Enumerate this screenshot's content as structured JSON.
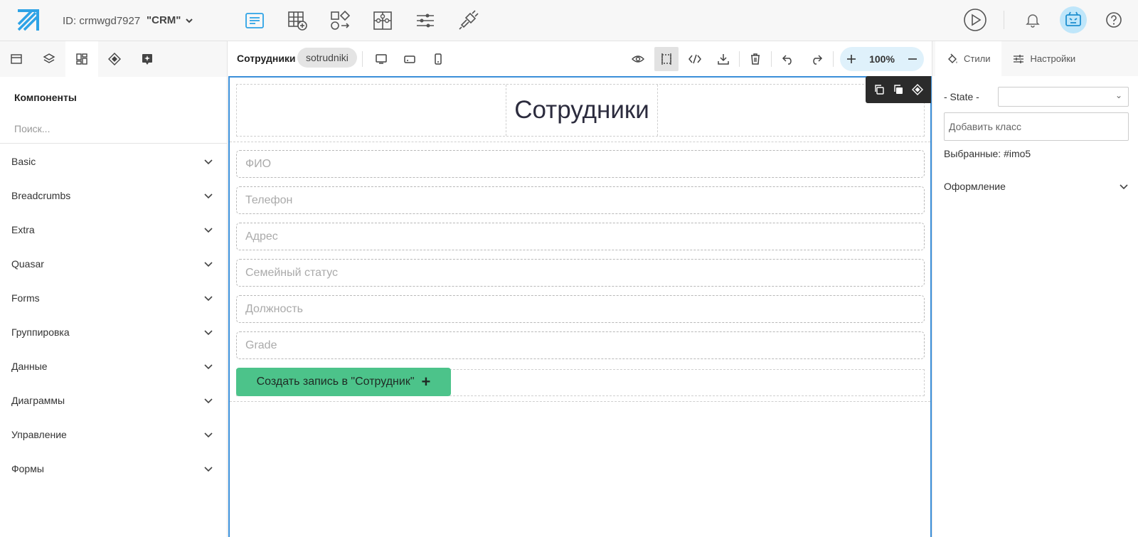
{
  "header": {
    "project_id": "ID: crmwgd7927",
    "project_name": "\"CRM\"",
    "tools": [
      "pages-icon",
      "table-add-icon",
      "shapes-icon",
      "puzzle-icon",
      "sliders-icon",
      "plug-icon"
    ]
  },
  "left_panel": {
    "components_title": "Компоненты",
    "search_placeholder": "Поиск...",
    "categories": [
      "Basic",
      "Breadcrumbs",
      "Extra",
      "Quasar",
      "Forms",
      "Группировка",
      "Данные",
      "Диаграммы",
      "Управление",
      "Формы"
    ]
  },
  "canvas_toolbar": {
    "page_name": "Сотрудники",
    "page_slug": "sotrudniki",
    "zoom": "100%"
  },
  "canvas": {
    "title": "Сотрудники",
    "fields": [
      "ФИО",
      "Телефон",
      "Адрес",
      "Семейный статус",
      "Должность",
      "Grade"
    ],
    "create_button": "Создать запись в \"Сотрудник\"",
    "create_button_icon": "+"
  },
  "right_panel": {
    "tab_styles": "Стили",
    "tab_settings": "Настройки",
    "state_label": "- State -",
    "class_placeholder": "Добавить класс",
    "selected": "Выбранные: #imo5",
    "section_design": "Оформление"
  },
  "colors": {
    "accent": "#3b8fd9",
    "button_green": "#4cc38a",
    "zoom_bg": "#dff1fb",
    "avatar_bg": "#bfe6fa"
  }
}
